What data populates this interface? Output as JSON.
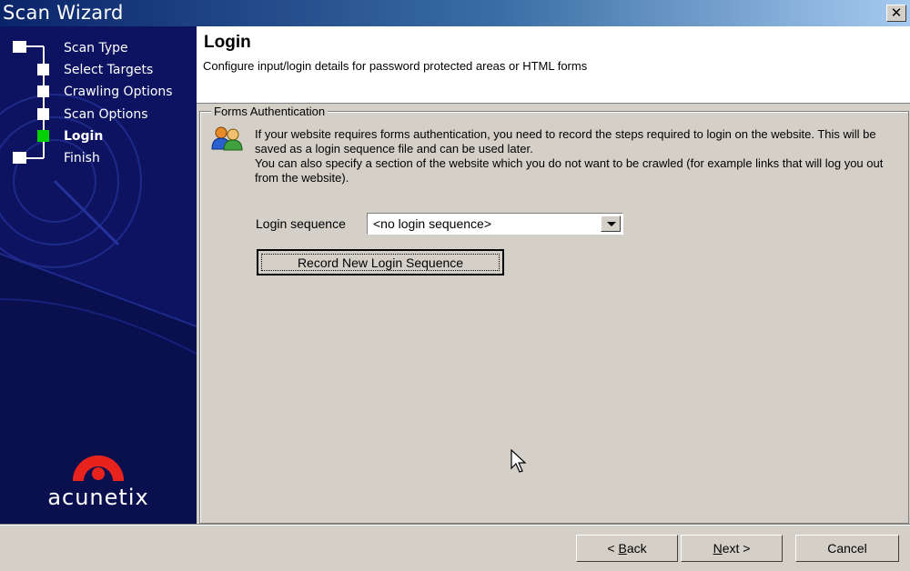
{
  "window": {
    "title": "Scan Wizard",
    "close_label": "✕"
  },
  "steps": [
    {
      "label": "Scan Type",
      "active": false
    },
    {
      "label": "Select Targets",
      "active": false
    },
    {
      "label": "Crawling Options",
      "active": false
    },
    {
      "label": "Scan Options",
      "active": false
    },
    {
      "label": "Login",
      "active": true
    },
    {
      "label": "Finish",
      "active": false
    }
  ],
  "brand": {
    "logo_text": "acunetix",
    "logo_color": "#e8231e"
  },
  "header": {
    "title": "Login",
    "description": "Configure input/login details for password protected areas or HTML forms"
  },
  "forms_auth": {
    "legend": "Forms Authentication",
    "info_icon": "users-icon",
    "info_line1": "If your website requires forms authentication, you need to record the steps required to login on the website. This will be saved as a login sequence file and can be used later.",
    "info_line2": "You can also specify a section of the website which you do not want to be crawled (for example links that will log you out from the website).",
    "login_sequence_label": "Login sequence",
    "login_sequence_value": "<no login sequence>",
    "record_button": "Record New Login Sequence"
  },
  "footer": {
    "back_prefix": "< ",
    "back_key": "B",
    "back_rest": "ack",
    "next_key": "N",
    "next_rest": "ext >",
    "cancel": "Cancel"
  }
}
